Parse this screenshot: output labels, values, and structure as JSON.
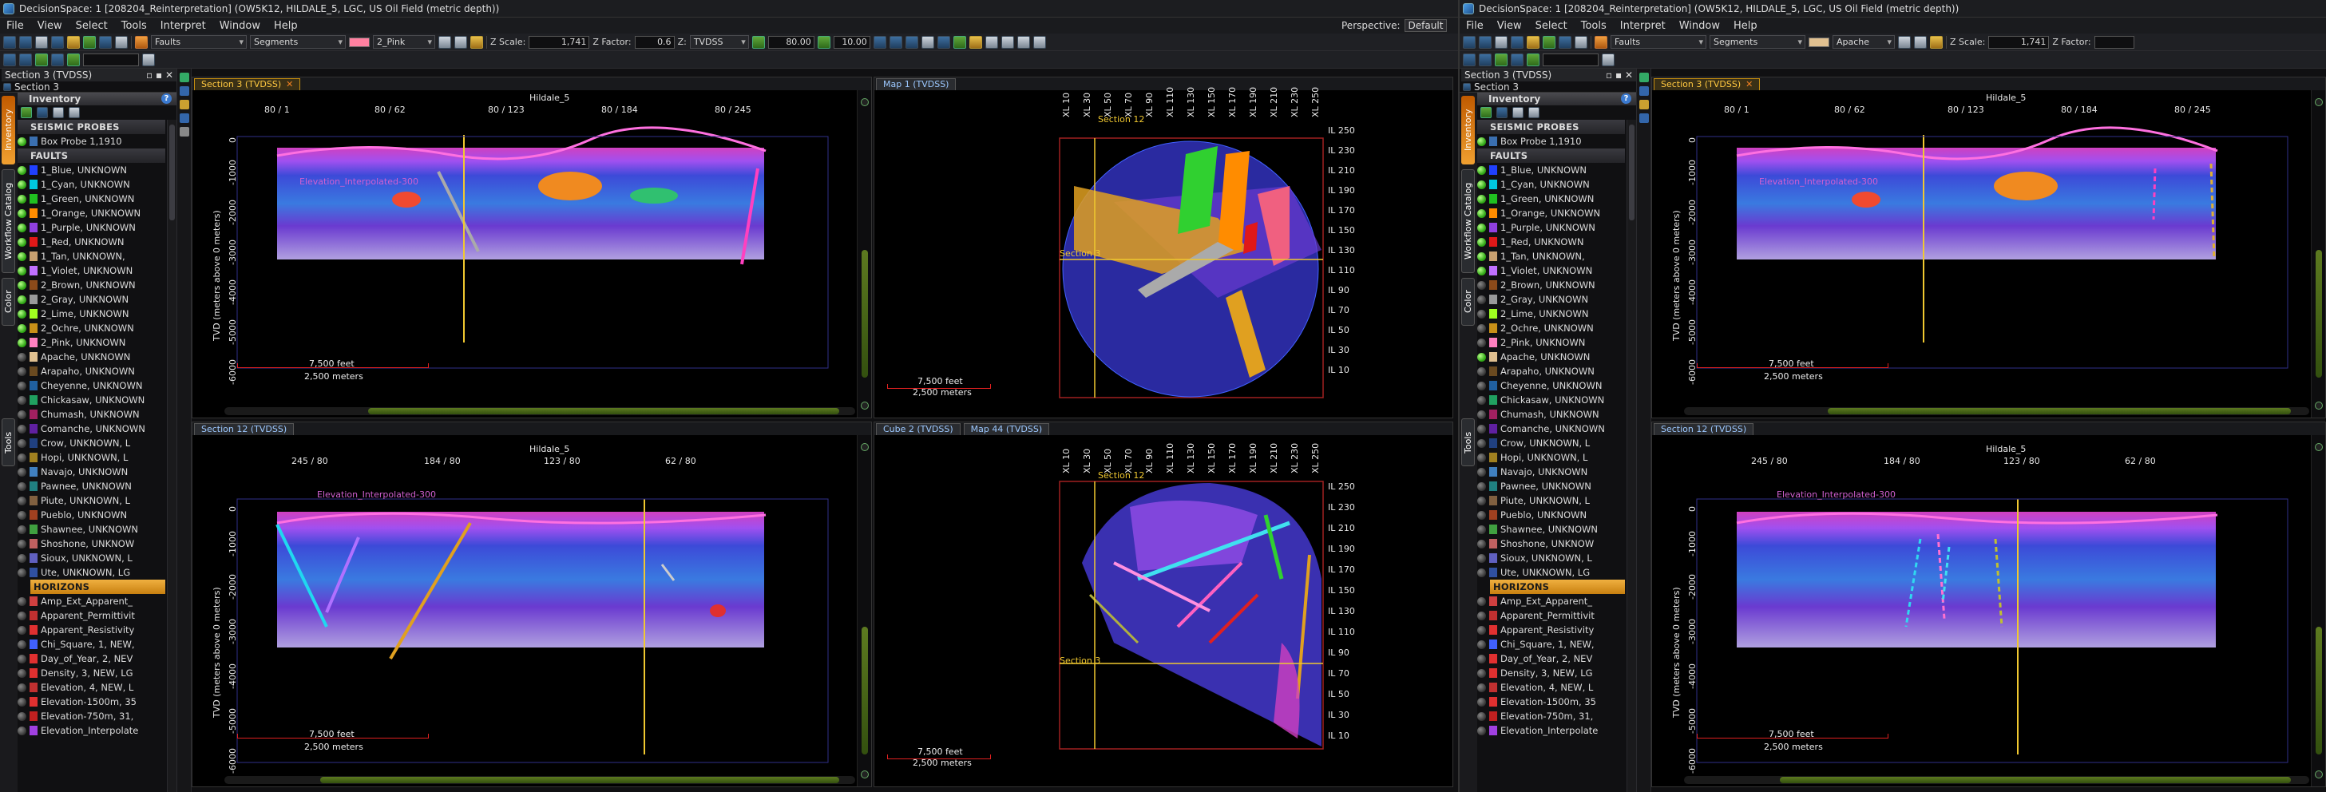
{
  "windows": [
    {
      "title": "DecisionSpace: 1 [208204_Reinterpretation] (OW5K12, HILDALE_5, LGC, US Oil Field (metric depth))",
      "menu": [
        "File",
        "View",
        "Select",
        "Tools",
        "Interpret",
        "Window",
        "Help"
      ],
      "perspective_label": "Perspective:",
      "perspective_value": "Default",
      "toolbar": {
        "layer_select": "Faults",
        "mode_select": "Segments",
        "color_name": "2_Pink",
        "color_hex": "#ff80a0",
        "z_scale_label": "Z Scale:",
        "z_scale": "1,741",
        "z_factor_label": "Z Factor:",
        "z_factor": "0.6",
        "domain_label": "Z:",
        "domain": "TVDSS",
        "speed_a": "80.00",
        "speed_b": "10.00"
      },
      "tree": {
        "window_title": "Section 3 (TVDSS)",
        "subtitle": "Section 3",
        "tabs": [
          "Inventory",
          "Workflow Catalog",
          "Color",
          "Tools"
        ],
        "header": "Inventory",
        "sections": {
          "seismic": "SEISMIC PROBES",
          "faults": "FAULTS",
          "horizons": "HORIZONS"
        },
        "seismic_items": [
          {
            "label": "Box Probe 1,1910",
            "color": "#3a6fb0",
            "on": true
          }
        ],
        "fault_items": [
          {
            "label": "1_Blue, UNKNOWN",
            "color": "#2040ff",
            "on": true
          },
          {
            "label": "1_Cyan, UNKNOWN",
            "color": "#00c8e0",
            "on": true
          },
          {
            "label": "1_Green, UNKNOWN",
            "color": "#20c020",
            "on": true
          },
          {
            "label": "1_Orange, UNKNOWN",
            "color": "#ff8c00",
            "on": true
          },
          {
            "label": "1_Purple, UNKNOWN",
            "color": "#9040e0",
            "on": true
          },
          {
            "label": "1_Red, UNKNOWN",
            "color": "#e01818",
            "on": true
          },
          {
            "label": "1_Tan, UNKNOWN,",
            "color": "#c8a070",
            "on": true
          },
          {
            "label": "1_Violet, UNKNOWN",
            "color": "#c070ff",
            "on": true
          },
          {
            "label": "2_Brown, UNKNOWN",
            "color": "#8b4a1a",
            "on": true
          },
          {
            "label": "2_Gray, UNKNOWN",
            "color": "#9a9a9a",
            "on": true
          },
          {
            "label": "2_Lime, UNKNOWN",
            "color": "#a0ff20",
            "on": true
          },
          {
            "label": "2_Ochre, UNKNOWN",
            "color": "#c89018",
            "on": true
          },
          {
            "label": "2_Pink, UNKNOWN",
            "color": "#ff80c0",
            "on": true
          },
          {
            "label": "Apache, UNKNOWN",
            "color": "#e0c090",
            "on": false
          },
          {
            "label": "Arapaho, UNKNOWN",
            "color": "#6a4a20",
            "on": false
          },
          {
            "label": "Cheyenne, UNKNOWN",
            "color": "#2060a0",
            "on": false
          },
          {
            "label": "Chickasaw, UNKNOWN",
            "color": "#20a060",
            "on": false
          },
          {
            "label": "Chumash, UNKNOWN",
            "color": "#a02060",
            "on": false
          },
          {
            "label": "Comanche, UNKNOWN",
            "color": "#6020a0",
            "on": false
          },
          {
            "label": "Crow, UNKNOWN, L",
            "color": "#204080",
            "on": false
          },
          {
            "label": "Hopi, UNKNOWN, L",
            "color": "#a08020",
            "on": false
          },
          {
            "label": "Navajo, UNKNOWN",
            "color": "#4080c0",
            "on": false
          },
          {
            "label": "Pawnee, UNKNOWN",
            "color": "#208080",
            "on": false
          },
          {
            "label": "Piute, UNKNOWN, L",
            "color": "#806040",
            "on": false
          },
          {
            "label": "Pueblo, UNKNOWN",
            "color": "#a04020",
            "on": false
          },
          {
            "label": "Shawnee, UNKNOWN",
            "color": "#40a040",
            "on": false
          },
          {
            "label": "Shoshone, UNKNOW",
            "color": "#c06060",
            "on": false
          },
          {
            "label": "Sioux, UNKNOWN, L",
            "color": "#6060c0",
            "on": false
          },
          {
            "label": "Ute, UNKNOWN, LG",
            "color": "#3050a0",
            "on": false
          }
        ],
        "horizon_items": [
          {
            "label": "Amp_Ext_Apparent_",
            "color": "#d04040"
          },
          {
            "label": "Apparent_Permittivit",
            "color": "#c03030"
          },
          {
            "label": "Apparent_Resistivity",
            "color": "#e03030"
          },
          {
            "label": "Chi_Square, 1, NEW,",
            "color": "#4060ff"
          },
          {
            "label": "Day_of_Year, 2, NEV",
            "color": "#e03030"
          },
          {
            "label": "Density, 3, NEW, LG",
            "color": "#e03030"
          },
          {
            "label": "Elevation, 4, NEW, L",
            "color": "#c03030"
          },
          {
            "label": "Elevation-1500m, 35",
            "color": "#e03030"
          },
          {
            "label": "Elevation-750m, 31,",
            "color": "#c02020"
          },
          {
            "label": "Elevation_Interpolate",
            "color": "#a040e0"
          }
        ]
      }
    },
    {
      "title": "DecisionSpace: 1 [208204_Reinterpretation] (OW5K12, HILDALE_5, LGC, US Oil Field (metric depth))",
      "menu": [
        "File",
        "View",
        "Select",
        "Tools",
        "Interpret",
        "Window",
        "Help"
      ],
      "perspective_label": "",
      "perspective_value": "",
      "toolbar": {
        "layer_select": "Faults",
        "mode_select": "Segments",
        "color_name": "Apache",
        "color_hex": "#e0c090",
        "z_scale_label": "Z Scale:",
        "z_scale": "1,741",
        "z_factor_label": "Z Factor:",
        "z_factor": "",
        "domain_label": "",
        "domain": "",
        "speed_a": "",
        "speed_b": ""
      },
      "tree": {
        "window_title": "Section 3 (TVDSS)",
        "subtitle": "Section 3",
        "tabs": [
          "Inventory",
          "Workflow Catalog",
          "Color",
          "Tools"
        ],
        "header": "Inventory",
        "sections": {
          "seismic": "SEISMIC PROBES",
          "faults": "FAULTS",
          "horizons": "HORIZONS"
        },
        "seismic_items": [
          {
            "label": "Box Probe 1,1910",
            "color": "#3a6fb0",
            "on": true
          }
        ],
        "fault_items": [
          {
            "label": "1_Blue, UNKNOWN",
            "color": "#2040ff",
            "on": true
          },
          {
            "label": "1_Cyan, UNKNOWN",
            "color": "#00c8e0",
            "on": true
          },
          {
            "label": "1_Green, UNKNOWN",
            "color": "#20c020",
            "on": true
          },
          {
            "label": "1_Orange, UNKNOWN",
            "color": "#ff8c00",
            "on": true
          },
          {
            "label": "1_Purple, UNKNOWN",
            "color": "#9040e0",
            "on": true
          },
          {
            "label": "1_Red, UNKNOWN",
            "color": "#e01818",
            "on": true
          },
          {
            "label": "1_Tan, UNKNOWN,",
            "color": "#c8a070",
            "on": true
          },
          {
            "label": "1_Violet, UNKNOWN",
            "color": "#c070ff",
            "on": true
          },
          {
            "label": "2_Brown, UNKNOWN",
            "color": "#8b4a1a",
            "on": false
          },
          {
            "label": "2_Gray, UNKNOWN",
            "color": "#9a9a9a",
            "on": false
          },
          {
            "label": "2_Lime, UNKNOWN",
            "color": "#a0ff20",
            "on": false
          },
          {
            "label": "2_Ochre, UNKNOWN",
            "color": "#c89018",
            "on": false
          },
          {
            "label": "2_Pink, UNKNOWN",
            "color": "#ff80c0",
            "on": false
          },
          {
            "label": "Apache, UNKNOWN",
            "color": "#e0c090",
            "on": true
          },
          {
            "label": "Arapaho, UNKNOWN",
            "color": "#6a4a20",
            "on": false
          },
          {
            "label": "Cheyenne, UNKNOWN",
            "color": "#2060a0",
            "on": false
          },
          {
            "label": "Chickasaw, UNKNOWN",
            "color": "#20a060",
            "on": false
          },
          {
            "label": "Chumash, UNKNOWN",
            "color": "#a02060",
            "on": false
          },
          {
            "label": "Comanche, UNKNOWN",
            "color": "#6020a0",
            "on": false
          },
          {
            "label": "Crow, UNKNOWN, L",
            "color": "#204080",
            "on": false
          },
          {
            "label": "Hopi, UNKNOWN, L",
            "color": "#a08020",
            "on": false
          },
          {
            "label": "Navajo, UNKNOWN",
            "color": "#4080c0",
            "on": false
          },
          {
            "label": "Pawnee, UNKNOWN",
            "color": "#208080",
            "on": false
          },
          {
            "label": "Piute, UNKNOWN, L",
            "color": "#806040",
            "on": false
          },
          {
            "label": "Pueblo, UNKNOWN",
            "color": "#a04020",
            "on": false
          },
          {
            "label": "Shawnee, UNKNOWN",
            "color": "#40a040",
            "on": false
          },
          {
            "label": "Shoshone, UNKNOW",
            "color": "#c06060",
            "on": false
          },
          {
            "label": "Sioux, UNKNOWN, L",
            "color": "#6060c0",
            "on": false
          },
          {
            "label": "Ute, UNKNOWN, LG",
            "color": "#3050a0",
            "on": false
          }
        ],
        "horizon_items": [
          {
            "label": "Amp_Ext_Apparent_",
            "color": "#d04040"
          },
          {
            "label": "Apparent_Permittivit",
            "color": "#c03030"
          },
          {
            "label": "Apparent_Resistivity",
            "color": "#e03030"
          },
          {
            "label": "Chi_Square, 1, NEW,",
            "color": "#4060ff"
          },
          {
            "label": "Day_of_Year, 2, NEV",
            "color": "#e03030"
          },
          {
            "label": "Density, 3, NEW, LG",
            "color": "#e03030"
          },
          {
            "label": "Elevation, 4, NEW, L",
            "color": "#c03030"
          },
          {
            "label": "Elevation-1500m, 35",
            "color": "#e03030"
          },
          {
            "label": "Elevation-750m, 31,",
            "color": "#c02020"
          },
          {
            "label": "Elevation_Interpolate",
            "color": "#a040e0"
          }
        ]
      }
    }
  ],
  "panels": {
    "section3": {
      "tab": "Section 3 (TVDSS)",
      "survey": "Hildale_5",
      "top_ticks": [
        "80 / 1",
        "80 / 62",
        "80 / 123",
        "80 / 184",
        "80 / 245"
      ],
      "y_label": "TVD (meters above 0 meters)",
      "y_ticks": [
        "0",
        "-1000",
        "-2000",
        "-3000",
        "-4000",
        "-5000",
        "-6000"
      ],
      "horizon_label": "Elevation_Interpolated-300",
      "scale_ft": "7,500 feet",
      "scale_m": "2,500 meters"
    },
    "section12": {
      "tab": "Section 12 (TVDSS)",
      "survey": "Hildale_5",
      "top_ticks": [
        "245 / 80",
        "184 / 80",
        "123 / 80",
        "62 / 80"
      ],
      "y_label": "TVD (meters above 0 meters)",
      "y_ticks": [
        "0",
        "-1000",
        "-2000",
        "-3000",
        "-4000",
        "-5000",
        "-6000"
      ],
      "horizon_label": "Elevation_Interpolated-300",
      "scale_ft": "7,500 feet",
      "scale_m": "2,500 meters"
    },
    "map1": {
      "tab": "Map 1 (TVDSS)",
      "xl_ticks": [
        "XL 10",
        "XL 30",
        "XL 50",
        "XL 70",
        "XL 90",
        "XL 110",
        "XL 130",
        "XL 150",
        "XL 170",
        "XL 190",
        "XL 210",
        "XL 230",
        "XL 250"
      ],
      "il_ticks": [
        "IL 250",
        "IL 230",
        "IL 210",
        "IL 190",
        "IL 170",
        "IL 150",
        "IL 130",
        "IL 110",
        "IL 90",
        "IL 70",
        "IL 50",
        "IL 30",
        "IL 10"
      ],
      "label_section12": "Section 12",
      "label_section3": "Section 3",
      "scale_ft": "7,500 feet",
      "scale_m": "2,500 meters"
    },
    "map44": {
      "tab_a": "Cube 2 (TVDSS)",
      "tab_b": "Map 44 (TVDSS)",
      "xl_ticks": [
        "XL 10",
        "XL 30",
        "XL 50",
        "XL 70",
        "XL 90",
        "XL 110",
        "XL 130",
        "XL 150",
        "XL 170",
        "XL 190",
        "XL 210",
        "XL 230",
        "XL 250"
      ],
      "il_ticks": [
        "IL 250",
        "IL 230",
        "IL 210",
        "IL 190",
        "IL 170",
        "IL 150",
        "IL 130",
        "IL 110",
        "IL 90",
        "IL 70",
        "IL 50",
        "IL 30",
        "IL 10"
      ],
      "label_section12": "Section 12",
      "label_section3": "Section 3",
      "scale_ft": "7,500 feet",
      "scale_m": "2,500 meters"
    }
  }
}
